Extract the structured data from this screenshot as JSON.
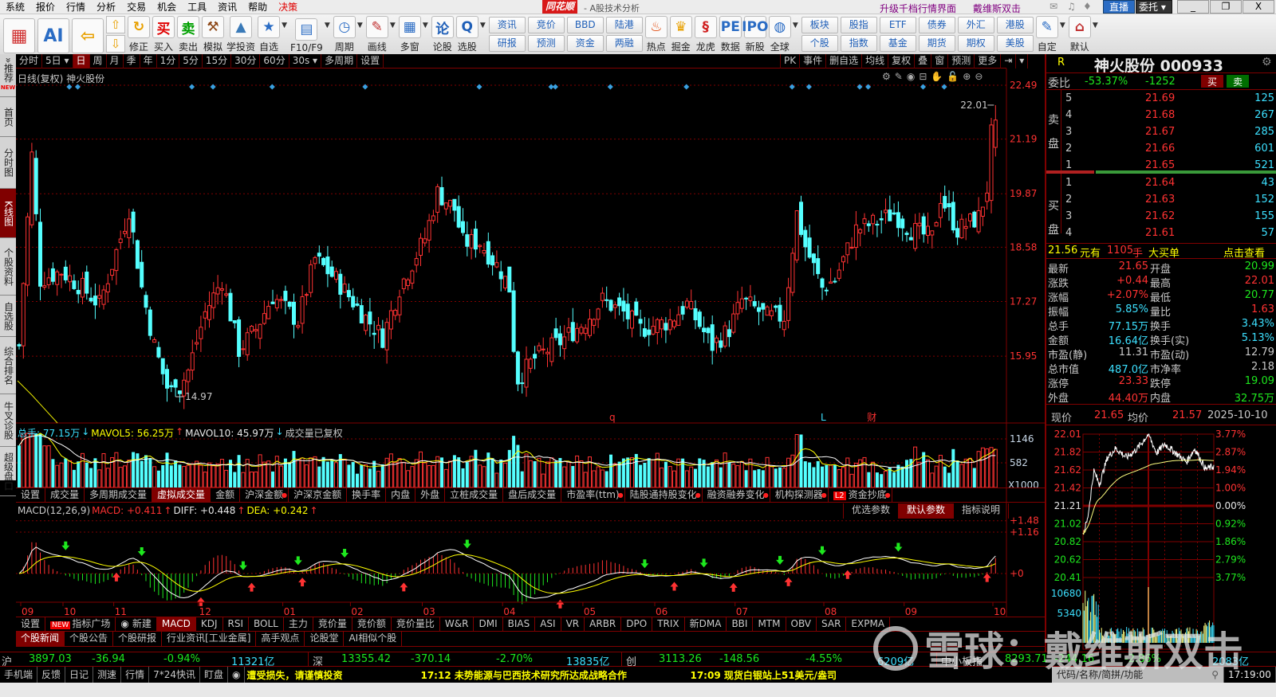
{
  "menu": [
    "系统",
    "报价",
    "行情",
    "分析",
    "交易",
    "机会",
    "工具",
    "资讯",
    "帮助",
    "决策"
  ],
  "titlebar": {
    "logo": "同花顺",
    "subtitle": "- A股技术分析",
    "promo": "升级千档行情界面",
    "user": "戴维斯双击",
    "live": "直播",
    "trade": "委托",
    "minimize": "_",
    "restore": "❐",
    "close": "X"
  },
  "toolbar": {
    "big": [
      {
        "name": "color-block",
        "glyph": "▦",
        "color": "#d03030"
      },
      {
        "name": "ai",
        "glyph": "AI",
        "color": "#2a6cc4"
      },
      {
        "name": "back",
        "glyph": "⇦",
        "color": "#e8a000"
      }
    ],
    "updown": [
      "⇧",
      "⇩"
    ],
    "tools": [
      {
        "label": "修正",
        "glyph": "↻",
        "color": "#e8a000"
      },
      {
        "label": "买入",
        "glyph": "买",
        "color": "#e00000"
      },
      {
        "label": "卖出",
        "glyph": "卖",
        "color": "#00a000"
      },
      {
        "label": "模拟",
        "glyph": "⚒",
        "color": "#8b4513"
      },
      {
        "label": "学投资",
        "glyph": "▲",
        "color": "#3a7ab8"
      },
      {
        "label": "自选",
        "glyph": "★",
        "color": "#2a6cc4",
        "dd": true
      },
      {
        "label": "F10/F9",
        "glyph": "▤",
        "color": "#2a6cc4",
        "dd": true
      },
      {
        "label": "周期",
        "glyph": "◷",
        "color": "#2a6cc4",
        "dd": true
      },
      {
        "label": "画线",
        "glyph": "✎",
        "color": "#c03030",
        "dd": true
      },
      {
        "label": "多窗",
        "glyph": "▦",
        "color": "#2a6cc4",
        "dd": true
      },
      {
        "label": "论股",
        "glyph": "论",
        "color": "#1f5fb8"
      },
      {
        "label": "选股",
        "glyph": "Q",
        "color": "#1f5fb8",
        "dd": true
      }
    ],
    "pairs1": [
      [
        "资讯",
        "研报"
      ],
      [
        "竞价",
        "预测"
      ],
      [
        "BBD",
        "资金"
      ],
      [
        "陆港",
        "两融"
      ]
    ],
    "tools2": [
      {
        "label": "热点",
        "glyph": "♨",
        "color": "#e04000"
      },
      {
        "label": "掘金",
        "glyph": "♛",
        "color": "#e8a000"
      },
      {
        "label": "龙虎",
        "glyph": "§",
        "color": "#d02020"
      },
      {
        "label": "数据",
        "glyph": "PE",
        "color": "#2a6cc4"
      },
      {
        "label": "新股",
        "glyph": "IPO",
        "color": "#2a6cc4"
      },
      {
        "label": "全球",
        "glyph": "◍",
        "color": "#2a6cc4",
        "dd": true
      }
    ],
    "pairs2": [
      [
        "板块",
        "个股"
      ],
      [
        "股指",
        "指数"
      ],
      [
        "ETF",
        "基金"
      ],
      [
        "债券",
        "期货"
      ],
      [
        "外汇",
        "期权"
      ],
      [
        "港股",
        "美股"
      ]
    ],
    "tools3": [
      {
        "label": "自定",
        "glyph": "✎",
        "color": "#2a6cc4",
        "dd": true
      },
      {
        "label": "默认",
        "glyph": "⌂",
        "color": "#c03030",
        "dd": true
      }
    ]
  },
  "sidebar": [
    {
      "label": "»推荐",
      "new": "NEW"
    },
    {
      "label": "首页"
    },
    {
      "label": "分时图"
    },
    {
      "label": "K线图",
      "active": true
    },
    {
      "label": "个股资料"
    },
    {
      "label": "自选股"
    },
    {
      "label": "综合排名"
    },
    {
      "label": "牛叉诊股"
    },
    {
      "label": "超级盘口"
    }
  ],
  "periods": [
    {
      "label": "分时"
    },
    {
      "label": "5日 ▾"
    },
    {
      "label": "日",
      "active": true
    },
    {
      "label": "周"
    },
    {
      "label": "月"
    },
    {
      "label": "季"
    },
    {
      "label": "年"
    },
    {
      "label": "1分"
    },
    {
      "label": "5分"
    },
    {
      "label": "15分"
    },
    {
      "label": "30分"
    },
    {
      "label": "60分"
    },
    {
      "label": "30s ▾"
    },
    {
      "label": "多周期"
    },
    {
      "label": "设置"
    }
  ],
  "period_right": [
    "PK",
    "事件",
    "删自选",
    "均线",
    "复权",
    "叠",
    "窗",
    "预测",
    "更多",
    "⇥",
    "▾"
  ],
  "chart": {
    "title": "日线(复权) 神火股份",
    "tools": [
      "⚙",
      "✎",
      "◉",
      "⊟",
      "✋",
      "🔓",
      "⊕",
      "⊖"
    ],
    "price_axis": [
      "22.49",
      "21.19",
      "19.87",
      "18.58",
      "17.27",
      "15.95"
    ],
    "high_label": "22.01",
    "low_label": "14.97",
    "event_markers": [
      {
        "text": "q",
        "color": "#ff3232"
      },
      {
        "text": "L",
        "color": "#3ce0ff"
      },
      {
        "text": "财",
        "color": "#ff3232"
      }
    ]
  },
  "volume": {
    "header": [
      {
        "text": "总手: 77.15万",
        "color": "#3ce0ff"
      },
      {
        "text": "↓",
        "color": "#3ce0ff"
      },
      {
        "text": "MAVOL5: 56.25万",
        "color": "#ffff00"
      },
      {
        "text": "↑",
        "color": "#ff3232"
      },
      {
        "text": "MAVOL10: 45.97万",
        "color": "#e8e8e8"
      },
      {
        "text": "↓",
        "color": "#3ce0ff"
      },
      {
        "text": "成交量已复权",
        "color": "#c8c8c8"
      }
    ],
    "axis": [
      "1146",
      "582",
      "X1000"
    ],
    "tabs": [
      {
        "label": "设置"
      },
      {
        "label": "成交量"
      },
      {
        "label": "多周期成交量"
      },
      {
        "label": "虚拟成交量",
        "active": true
      },
      {
        "label": "金额"
      },
      {
        "label": "沪深金额",
        "dot": true
      },
      {
        "label": "沪深京金额"
      },
      {
        "label": "换手率"
      },
      {
        "label": "内盘"
      },
      {
        "label": "外盘"
      },
      {
        "label": "立桩成交量"
      },
      {
        "label": "盘后成交量"
      },
      {
        "label": "市盈率(ttm)",
        "dot": true
      },
      {
        "label": "陆股通持股变化",
        "dot": true
      },
      {
        "label": "融资融券变化",
        "dot": true
      },
      {
        "label": "机构探测器",
        "dot": true
      },
      {
        "label": "资金抄底",
        "badge": "L2",
        "dot": true
      }
    ]
  },
  "macd": {
    "header": [
      {
        "text": "MACD(12,26,9)",
        "color": "#c8c8c8"
      },
      {
        "text": " MACD: +0.411",
        "color": "#ff3232"
      },
      {
        "text": "↑",
        "color": "#ff3232"
      },
      {
        "text": "DIFF: +0.448",
        "color": "#e8e8e8"
      },
      {
        "text": "↑",
        "color": "#ff3232"
      },
      {
        "text": "DEA: +0.242",
        "color": "#ffff00"
      },
      {
        "text": "↑",
        "color": "#ff3232"
      }
    ],
    "buttons": [
      {
        "label": "优选参数"
      },
      {
        "label": "默认参数",
        "active": true
      },
      {
        "label": "指标说明"
      }
    ],
    "axis": [
      "+1.48",
      "+1.16",
      "+0"
    ]
  },
  "dates": [
    "09",
    "10",
    "11",
    "12",
    "01",
    "02",
    "03",
    "04",
    "05",
    "06",
    "07",
    "08",
    "09",
    "10"
  ],
  "indicator_tabs": [
    {
      "label": "设置"
    },
    {
      "label": "指标广场",
      "badge": "NEW"
    },
    {
      "label": "新建",
      "icon": "◉"
    },
    {
      "label": "MACD",
      "active": true
    },
    {
      "label": "KDJ"
    },
    {
      "label": "RSI"
    },
    {
      "label": "BOLL"
    },
    {
      "label": "主力"
    },
    {
      "label": "竞价量"
    },
    {
      "label": "竞价额"
    },
    {
      "label": "竞价量比"
    },
    {
      "label": "W&R"
    },
    {
      "label": "DMI"
    },
    {
      "label": "BIAS"
    },
    {
      "label": "ASI"
    },
    {
      "label": "VR"
    },
    {
      "label": "ARBR"
    },
    {
      "label": "DPO"
    },
    {
      "label": "TRIX"
    },
    {
      "label": "新DMA"
    },
    {
      "label": "BBI"
    },
    {
      "label": "MTM"
    },
    {
      "label": "OBV"
    },
    {
      "label": "SAR"
    },
    {
      "label": "EXPMA"
    }
  ],
  "news_tabs": [
    {
      "label": "个股新闻",
      "active": true
    },
    {
      "label": "个股公告"
    },
    {
      "label": "个股研报"
    },
    {
      "label": "行业资讯[工业金属]"
    },
    {
      "label": "高手观点"
    },
    {
      "label": "论股堂"
    },
    {
      "label": "AI相似个股"
    }
  ],
  "quote": {
    "flag": "R",
    "name": "神火股份 000933",
    "weibi_label": "委比",
    "weibi_pct": "-53.37%",
    "weibi_diff": "-1252",
    "buy_btn": "买",
    "sell_btn": "卖",
    "sell_label": [
      "卖",
      "盘"
    ],
    "buy_label": [
      "买",
      "盘"
    ],
    "asks": [
      {
        "lvl": "5",
        "price": "21.69",
        "vol": "125"
      },
      {
        "lvl": "4",
        "price": "21.68",
        "vol": "267"
      },
      {
        "lvl": "3",
        "price": "21.67",
        "vol": "285"
      },
      {
        "lvl": "2",
        "price": "21.66",
        "vol": "601"
      },
      {
        "lvl": "1",
        "price": "21.65",
        "vol": "521"
      }
    ],
    "bids": [
      {
        "lvl": "1",
        "price": "21.64",
        "vol": "43"
      },
      {
        "lvl": "2",
        "price": "21.63",
        "vol": "152"
      },
      {
        "lvl": "3",
        "price": "21.62",
        "vol": "155"
      },
      {
        "lvl": "4",
        "price": "21.61",
        "vol": "57"
      }
    ],
    "bigorder": {
      "price": "21.56",
      "t1": "元有",
      "vol": "1105",
      "t2": "手",
      "t3": "大买单",
      "link": "点击查看"
    },
    "stats": [
      [
        "最新",
        "21.65",
        "red",
        "开盘",
        "20.99",
        "grn"
      ],
      [
        "涨跌",
        "+0.44",
        "red",
        "最高",
        "22.01",
        "red"
      ],
      [
        "涨幅",
        "+2.07%",
        "red",
        "最低",
        "20.77",
        "grn"
      ],
      [
        "振幅",
        "5.85%",
        "cyn",
        "量比",
        "1.63",
        "red"
      ],
      [
        "总手",
        "77.15万",
        "cyn",
        "换手",
        "3.43%",
        "cyn"
      ],
      [
        "金额",
        "16.64亿",
        "cyn",
        "换手(实)",
        "5.13%",
        "cyn"
      ],
      [
        "市盈(静)",
        "11.31",
        "gry",
        "市盈(动)",
        "12.79",
        "gry"
      ],
      [
        "总市值",
        "487.0亿",
        "cyn",
        "市净率",
        "2.18",
        "gry"
      ],
      [
        "涨停",
        "23.33",
        "red",
        "跌停",
        "19.09",
        "grn"
      ],
      [
        "外盘",
        "44.40万",
        "red",
        "内盘",
        "32.75万",
        "grn"
      ]
    ]
  },
  "intraday": {
    "now_label": "现价",
    "now": "21.65",
    "avg_label": "均价",
    "avg": "21.57",
    "date": "2025-10-10",
    "left_axis": [
      {
        "t": "22.01",
        "c": "red"
      },
      {
        "t": "21.82",
        "c": "red"
      },
      {
        "t": "21.62",
        "c": "red"
      },
      {
        "t": "21.42",
        "c": "red"
      },
      {
        "t": "21.21",
        "c": "wht"
      },
      {
        "t": "21.02",
        "c": "grn"
      },
      {
        "t": "20.82",
        "c": "grn"
      },
      {
        "t": "20.62",
        "c": "grn"
      },
      {
        "t": "20.41",
        "c": "grn"
      }
    ],
    "right_axis": [
      {
        "t": "3.77%",
        "c": "red"
      },
      {
        "t": "2.87%",
        "c": "red"
      },
      {
        "t": "1.94%",
        "c": "red"
      },
      {
        "t": "1.00%",
        "c": "red"
      },
      {
        "t": "0.00%",
        "c": "wht"
      },
      {
        "t": "0.92%",
        "c": "grn"
      },
      {
        "t": "1.86%",
        "c": "grn"
      },
      {
        "t": "2.79%",
        "c": "grn"
      },
      {
        "t": "3.77%",
        "c": "grn"
      }
    ],
    "vol_axis": [
      "10680",
      "5340"
    ],
    "prev_close": 21.21,
    "range": [
      20.41,
      22.01
    ]
  },
  "indices": [
    {
      "name": "沪",
      "price": "3897.03",
      "chg": "-36.94",
      "pct": "-0.94%",
      "amt": "11321亿"
    },
    {
      "name": "深",
      "price": "13355.42",
      "chg": "-370.14",
      "pct": "-2.70%",
      "amt": "13835亿"
    },
    {
      "name": "创",
      "price": "3113.26",
      "chg": "-148.56",
      "pct": "-4.55%",
      "amt": "6209亿"
    },
    {
      "name": "中小板指",
      "price": "8293.71",
      "chg": "-244.16",
      "pct": "-2.86%",
      "amt": "2083亿"
    }
  ],
  "status": {
    "items": [
      "手机端",
      "反馈",
      "日记",
      "测速",
      "行情",
      "7*24快讯",
      "盯盘"
    ],
    "ticker": [
      "遭受损失，请谨慎投资",
      "17:12 未势能源与巴西技术研究所达成战略合作",
      "17:09 现货白银站上51美元/盎司"
    ],
    "search_placeholder": "代码/名称/简拼/功能",
    "time": "17:19:00"
  },
  "watermark": "雪球：戴维斯双击",
  "chart_data": {
    "type": "candlestick",
    "title": "日线(复权) 神火股份",
    "ylim": [
      14.97,
      22.49
    ],
    "close_keypoints": [
      [
        0,
        16.2
      ],
      [
        3,
        20.8
      ],
      [
        5,
        17.8
      ],
      [
        10,
        18
      ],
      [
        15,
        17.6
      ],
      [
        19,
        17.2
      ],
      [
        24,
        18.8
      ],
      [
        26,
        19.5
      ],
      [
        29,
        17.6
      ],
      [
        32,
        16.2
      ],
      [
        35,
        15.2
      ],
      [
        37,
        15.0
      ],
      [
        40,
        15.6
      ],
      [
        44,
        17.0
      ],
      [
        48,
        17.8
      ],
      [
        52,
        16.1
      ],
      [
        56,
        16.6
      ],
      [
        60,
        17.4
      ],
      [
        66,
        16.8
      ],
      [
        70,
        18.3
      ],
      [
        75,
        17.8
      ],
      [
        81,
        17.0
      ],
      [
        86,
        16.4
      ],
      [
        90,
        17.6
      ],
      [
        96,
        18.8
      ],
      [
        99,
        19.9
      ],
      [
        103,
        19.5
      ],
      [
        105,
        18.7
      ],
      [
        109,
        18.7
      ],
      [
        114,
        18.0
      ],
      [
        116,
        17.6
      ],
      [
        117,
        16.2
      ],
      [
        118,
        15.4
      ],
      [
        122,
        15.9
      ],
      [
        128,
        16.3
      ],
      [
        134,
        16.8
      ],
      [
        138,
        17.3
      ],
      [
        143,
        17.0
      ],
      [
        147,
        16.6
      ],
      [
        154,
        16.8
      ],
      [
        158,
        17.2
      ],
      [
        164,
        16.2
      ],
      [
        168,
        16.6
      ],
      [
        171,
        17.3
      ],
      [
        177,
        16.9
      ],
      [
        181,
        16.9
      ],
      [
        184,
        19.4
      ],
      [
        186,
        18.6
      ],
      [
        190,
        17.6
      ],
      [
        193,
        17.8
      ],
      [
        198,
        19.0
      ],
      [
        203,
        19.2
      ],
      [
        207,
        19.4
      ],
      [
        211,
        19.0
      ],
      [
        216,
        18.8
      ],
      [
        218,
        19.8
      ],
      [
        222,
        19.0
      ],
      [
        227,
        19.3
      ],
      [
        229,
        20.0
      ],
      [
        230,
        21.3
      ],
      [
        231,
        21.65
      ]
    ],
    "intraday_keypoints": [
      [
        0,
        20.9
      ],
      [
        8,
        21.05
      ],
      [
        20,
        21.6
      ],
      [
        30,
        21.45
      ],
      [
        45,
        21.75
      ],
      [
        60,
        21.85
      ],
      [
        80,
        21.75
      ],
      [
        100,
        21.85
      ],
      [
        120,
        22.01
      ],
      [
        135,
        21.8
      ],
      [
        150,
        21.9
      ],
      [
        170,
        21.8
      ],
      [
        190,
        21.7
      ],
      [
        205,
        21.85
      ],
      [
        225,
        21.62
      ],
      [
        240,
        21.65
      ]
    ]
  }
}
